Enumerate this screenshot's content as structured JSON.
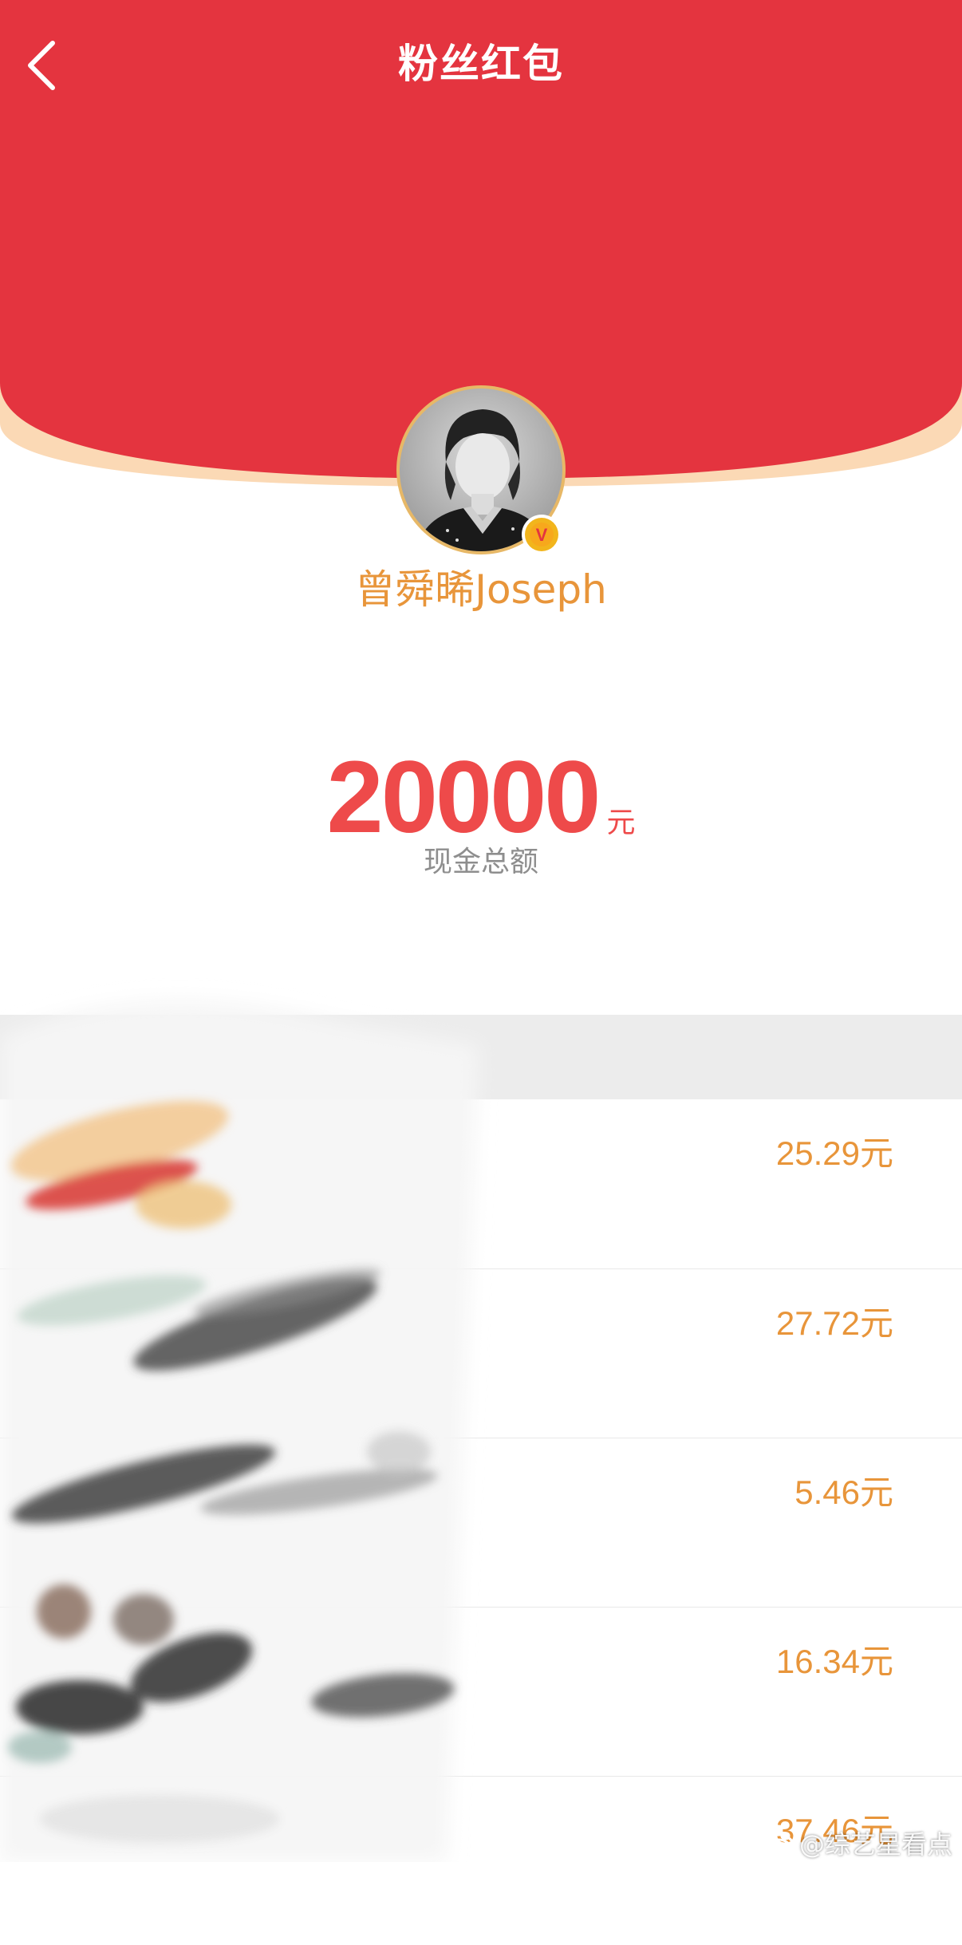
{
  "header": {
    "title": "粉丝红包"
  },
  "sender": {
    "name": "曾舜晞Joseph",
    "verified_badge": "V"
  },
  "total": {
    "amount": "20000",
    "unit": "元",
    "label": "现金总额"
  },
  "claims": [
    {
      "amount": "25.29元"
    },
    {
      "amount": "27.72元"
    },
    {
      "amount": "5.46元"
    },
    {
      "amount": "16.34元"
    },
    {
      "amount": "37.46元"
    }
  ],
  "watermark": {
    "text": "@综艺星看点"
  },
  "icons": {
    "back": "chevron-left-icon",
    "verified": "verified-v-icon",
    "watermark_logo": "weibo-logo-icon"
  },
  "colors": {
    "header_red": "#e4343f",
    "rim_peach": "#fbd9b5",
    "accent_orange": "#e8953a",
    "amount_red": "#ee4a4a",
    "badge_gold": "#f2b51c"
  }
}
